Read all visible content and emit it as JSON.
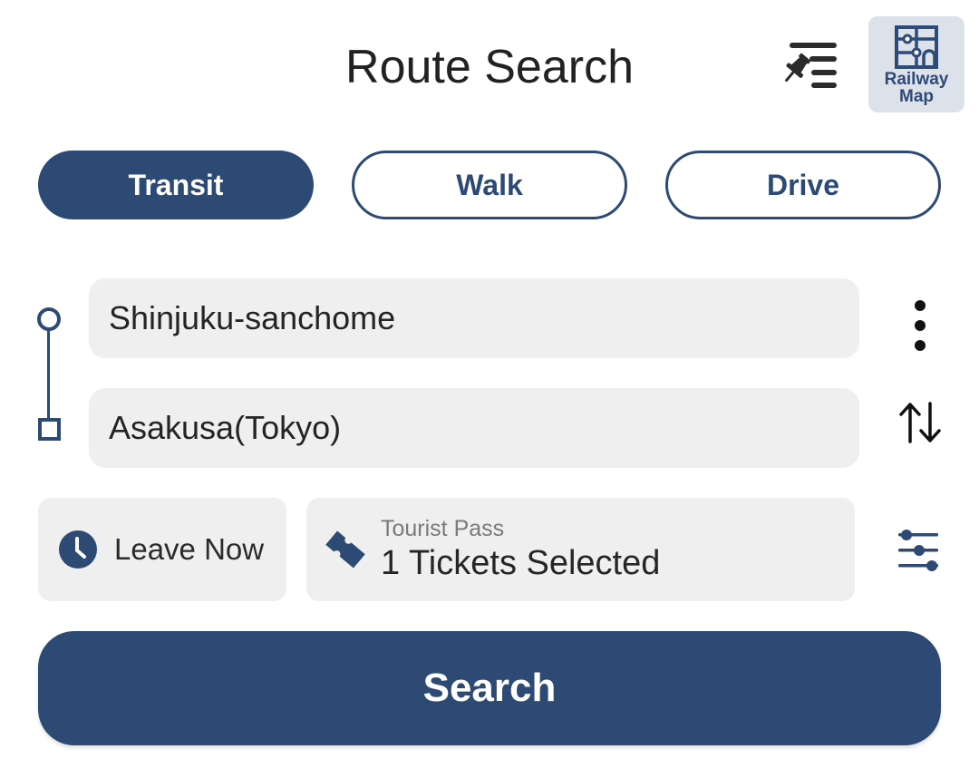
{
  "header": {
    "title": "Route Search",
    "pin_list_icon": "pin-list-icon",
    "railway_map": {
      "icon": "railway-map-icon",
      "label_line1": "Railway",
      "label_line2": "Map"
    }
  },
  "modes": {
    "tabs": [
      {
        "label": "Transit",
        "active": true
      },
      {
        "label": "Walk",
        "active": false
      },
      {
        "label": "Drive",
        "active": false
      }
    ]
  },
  "route": {
    "origin": "Shinjuku-sanchome",
    "destination": "Asakusa(Tokyo)",
    "more_icon": "more-vertical-icon",
    "swap_icon": "swap-vertical-icon"
  },
  "options": {
    "time": {
      "icon": "clock-icon",
      "label": "Leave Now"
    },
    "pass": {
      "icon": "ticket-icon",
      "sublabel": "Tourist Pass",
      "label": "1 Tickets Selected"
    },
    "filter_icon": "sliders-icon"
  },
  "search": {
    "label": "Search"
  },
  "colors": {
    "primary": "#2c4a74",
    "field_bg": "#efefef",
    "railway_bg": "#dde2ea"
  }
}
